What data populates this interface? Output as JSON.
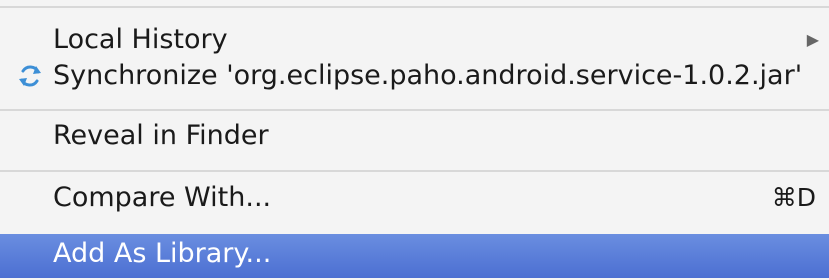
{
  "menu": {
    "items": [
      {
        "label": "Local History",
        "submenu_indicator": "▶"
      },
      {
        "label": "Synchronize 'org.eclipse.paho.android.service-1.0.2.jar'",
        "icon": "sync-icon"
      },
      {
        "label": "Reveal in Finder"
      },
      {
        "label": "Compare With...",
        "shortcut": "⌘D"
      },
      {
        "label": "Add As Library...",
        "highlighted": true
      }
    ]
  },
  "colors": {
    "background": "#f4f4f4",
    "separator": "#d8d8d8",
    "highlight": "#4c6fd2",
    "icon": "#3d8fd6"
  }
}
